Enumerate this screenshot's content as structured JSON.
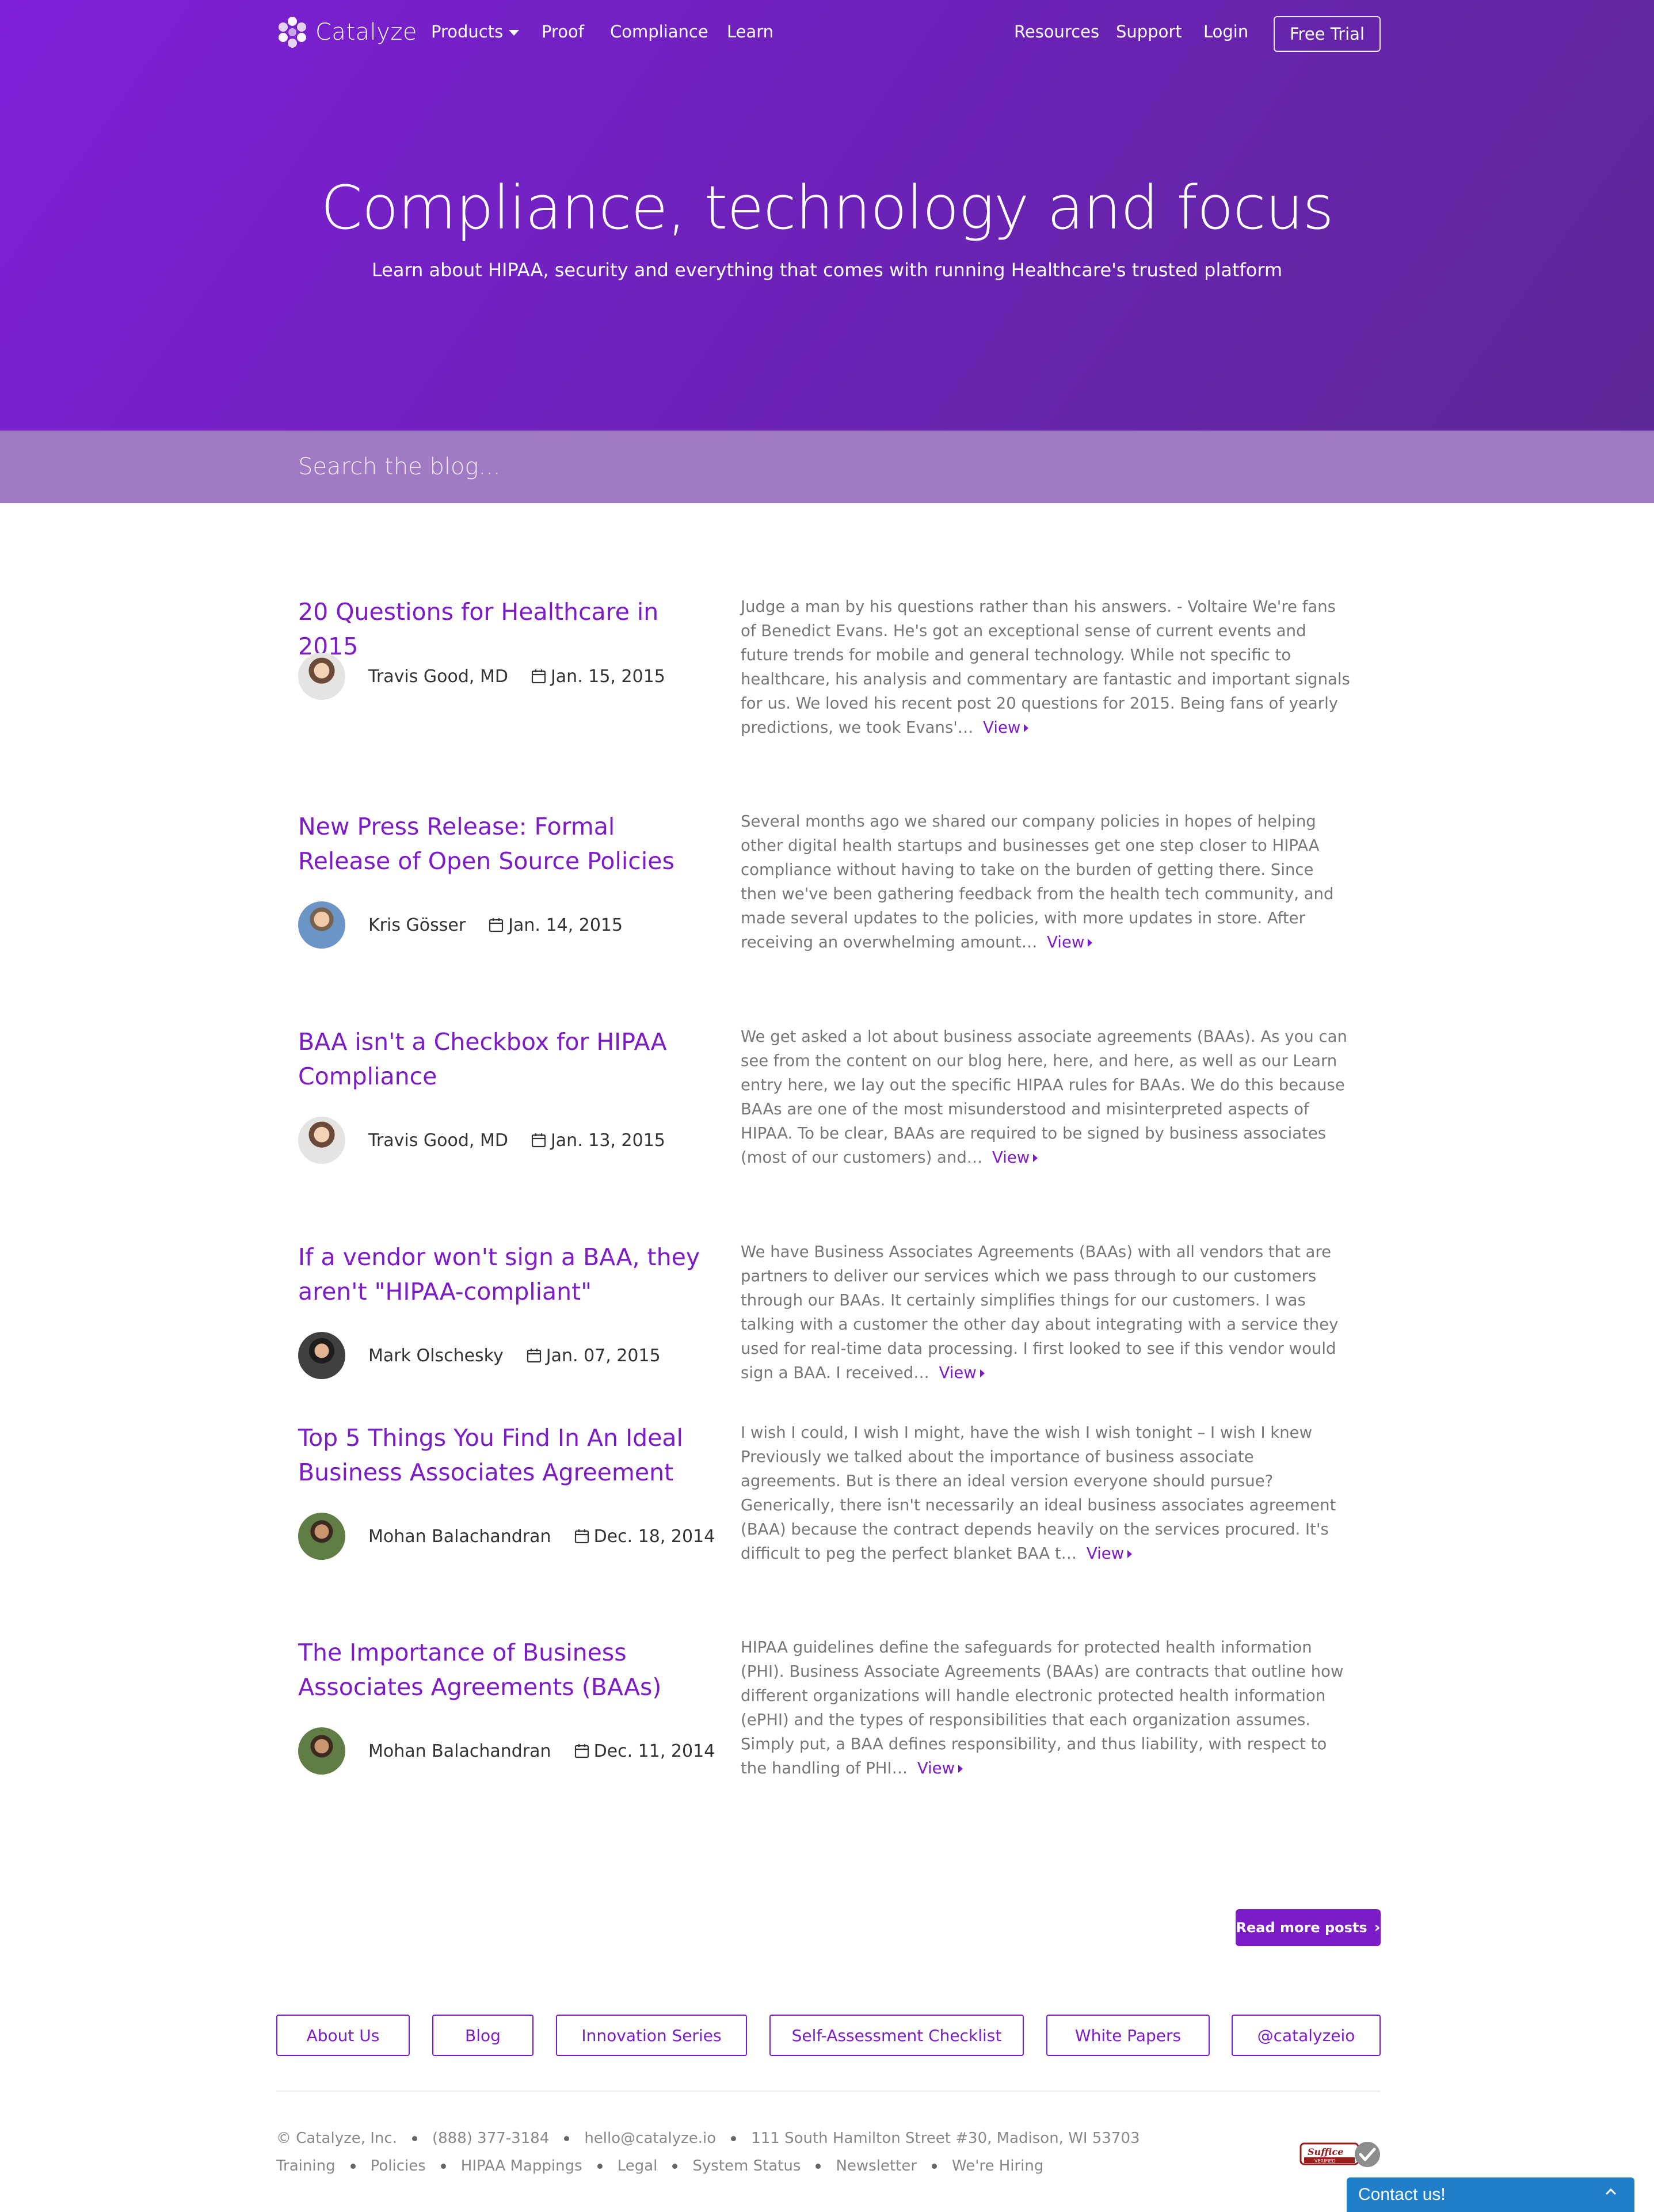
{
  "nav": {
    "logo_text": "Catalyze",
    "links": [
      "Products",
      "Proof",
      "Compliance",
      "Learn"
    ],
    "right_links": [
      "Resources",
      "Support",
      "Login"
    ],
    "cta": "Free Trial"
  },
  "hero": {
    "title": "Compliance, technology and focus",
    "subtitle": "Learn about HIPAA, security and everything that comes with running Healthcare's trusted platform"
  },
  "search": {
    "placeholder": "Search the blog..."
  },
  "posts": [
    {
      "title": "20 Questions for Healthcare in 2015",
      "author": "Travis Good, MD",
      "date": "Jan. 15, 2015",
      "excerpt": "Judge a man by his questions rather than his answers. - Voltaire We're fans of Benedict Evans. He's got an exceptional sense of current events and future trends for mobile and general technology. While not specific to healthcare, his analysis and commentary are fantastic and important signals for us. We loved his recent post 20 questions for 2015. Being fans of yearly predictions, we took Evans'…",
      "view": "View"
    },
    {
      "title": "New Press Release: Formal Release of Open Source Policies",
      "author": "Kris Gösser",
      "date": "Jan. 14, 2015",
      "excerpt": "Several months ago we shared our company policies in hopes of helping other digital health startups and businesses get one step closer to HIPAA compliance without having to take on the burden of getting there. Since then we've been gathering feedback from the health tech community, and made several updates to the policies, with more updates in store. After receiving an overwhelming amount…",
      "view": "View"
    },
    {
      "title": "BAA isn't a Checkbox for HIPAA Compliance",
      "author": "Travis Good, MD",
      "date": "Jan. 13, 2015",
      "excerpt": "We get asked a lot about business associate agreements (BAAs). As you can see from the content on our blog here, here, and here, as well as our Learn entry here, we lay out the specific HIPAA rules for BAAs. We do this because BAAs are one of the most misunderstood and misinterpreted aspects of HIPAA. To be clear, BAAs are required to be signed by business associates (most of our customers) and…",
      "view": "View"
    },
    {
      "title": "If a vendor won't sign a BAA, they aren't \"HIPAA-compliant\"",
      "author": "Mark Olschesky",
      "date": "Jan. 07, 2015",
      "excerpt": "We have Business Associates Agreements (BAAs) with all vendors that are partners to deliver our services which we pass through to our customers through our BAAs. It certainly simplifies things for our customers. I was talking with a customer the other day about integrating with a service they used for real-time data processing. I first looked to see if this vendor would sign a BAA. I received…",
      "view": "View"
    },
    {
      "title": "Top 5 Things You Find In An Ideal Business Associates Agreement",
      "author": "Mohan Balachandran",
      "date": "Dec. 18, 2014",
      "excerpt": "I wish I could, I wish I might, have the wish I wish tonight – I wish I knew Previously we talked about the importance of business associate agreements. But is there an ideal version everyone should pursue? Generically, there isn't necessarily an ideal business associates agreement (BAA) because the contract depends heavily on the services procured. It's difficult to peg the perfect blanket BAA t…",
      "view": "View"
    },
    {
      "title": "The Importance of Business Associates Agreements (BAAs)",
      "author": "Mohan Balachandran",
      "date": "Dec. 11, 2014",
      "excerpt": "HIPAA guidelines define the safeguards for protected health information (PHI). Business Associate Agreements (BAAs) are contracts that outline how different organizations will handle electronic protected health information (ePHI) and the types of responsibilities that each organization assumes. Simply put, a BAA defines responsibility, and thus liability, with respect to the handling of PHI…",
      "view": "View"
    }
  ],
  "read_more": "Read more posts",
  "footer": {
    "buttons": [
      "About Us",
      "Blog",
      "Innovation Series",
      "Self-Assessment Checklist",
      "White Papers",
      "@catalyzeio"
    ],
    "company": "© Catalyze, Inc.",
    "phone": "(888) 377-3184",
    "email": "hello@catalyze.io",
    "address": "111 South Hamilton Street #30, Madison, WI 53703",
    "links": [
      "Training",
      "Policies",
      "HIPAA Mappings",
      "Legal",
      "System Status",
      "Newsletter",
      "We're Hiring"
    ],
    "seal_text": "Suffice VERIFIED"
  },
  "contact_widget": {
    "label": "Contact us!"
  },
  "colors": {
    "brand_purple": "#7d1bc9",
    "hero_start": "#7e1fd8",
    "hero_end": "#5e2796",
    "search_bar": "#a07bc3",
    "contact_blue": "#1f7fc8"
  }
}
